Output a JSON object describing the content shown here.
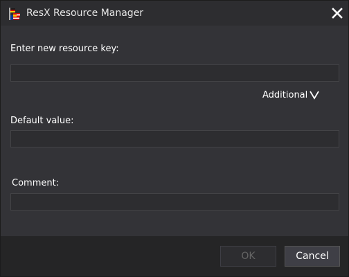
{
  "window": {
    "title": "ResX Resource Manager",
    "icon": "resx-flag-icon",
    "close_icon": "close-icon"
  },
  "form": {
    "key_label": "Enter new resource key:",
    "key_value": "",
    "additional_label": "Additional",
    "additional_icon": "chevron-down-icon",
    "default_label": "Default value:",
    "default_value": "",
    "comment_label": "Comment:",
    "comment_value": ""
  },
  "buttons": {
    "ok_label": "OK",
    "ok_enabled": false,
    "cancel_label": "Cancel"
  },
  "colors": {
    "titlebar_bg": "#2d2d30",
    "body_bg": "#333337",
    "footer_bg": "#252526",
    "text": "#ffffff",
    "disabled_text": "#656565"
  }
}
